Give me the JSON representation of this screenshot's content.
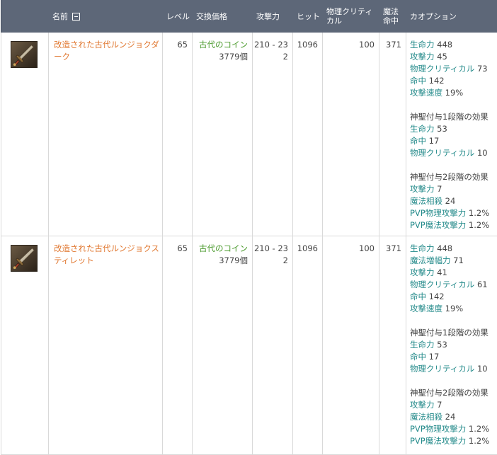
{
  "headers": {
    "name": "名前",
    "level": "レベル",
    "price": "交換価格",
    "attack": "攻撃力",
    "hit": "ヒット",
    "phys_crit": "物理クリティカル",
    "magic_acc": "魔法命中",
    "options": "カオプション"
  },
  "items": [
    {
      "name": "改造された古代ルンジョクダーク",
      "level": "65",
      "price_currency": "古代のコイン",
      "price_amount": "3779個",
      "attack": "210 - 232",
      "hit": "1096",
      "phys_crit": "100",
      "magic_acc": "371",
      "icon": "dagger-icon",
      "options": [
        {
          "type": "stat",
          "label": "生命力",
          "value": "448"
        },
        {
          "type": "stat",
          "label": "攻撃力",
          "value": "45"
        },
        {
          "type": "stat",
          "label": "物理クリティカル",
          "value": "73"
        },
        {
          "type": "stat",
          "label": "命中",
          "value": "142"
        },
        {
          "type": "stat",
          "label": "攻撃速度",
          "value": "19%"
        },
        {
          "type": "gap"
        },
        {
          "type": "heading",
          "text": "神聖付与1段階の効果"
        },
        {
          "type": "stat",
          "label": "生命力",
          "value": "53"
        },
        {
          "type": "stat",
          "label": "命中",
          "value": "17"
        },
        {
          "type": "stat",
          "label": "物理クリティカル",
          "value": "10"
        },
        {
          "type": "gap"
        },
        {
          "type": "heading",
          "text": "神聖付与2段階の効果"
        },
        {
          "type": "stat",
          "label": "攻撃力",
          "value": "7"
        },
        {
          "type": "stat",
          "label": "魔法相殺",
          "value": "24"
        },
        {
          "type": "stat",
          "label": "PVP物理攻撃力",
          "value": "1.2%"
        },
        {
          "type": "stat",
          "label": "PVP魔法攻撃力",
          "value": "1.2%"
        }
      ]
    },
    {
      "name": "改造された古代ルンジョクスティレット",
      "level": "65",
      "price_currency": "古代のコイン",
      "price_amount": "3779個",
      "attack": "210 - 232",
      "hit": "1096",
      "phys_crit": "100",
      "magic_acc": "371",
      "icon": "stiletto-icon",
      "options": [
        {
          "type": "stat",
          "label": "生命力",
          "value": "448"
        },
        {
          "type": "stat",
          "label": "魔法増幅力",
          "value": "71"
        },
        {
          "type": "stat",
          "label": "攻撃力",
          "value": "41"
        },
        {
          "type": "stat",
          "label": "物理クリティカル",
          "value": "61"
        },
        {
          "type": "stat",
          "label": "命中",
          "value": "142"
        },
        {
          "type": "stat",
          "label": "攻撃速度",
          "value": "19%"
        },
        {
          "type": "gap"
        },
        {
          "type": "heading",
          "text": "神聖付与1段階の効果"
        },
        {
          "type": "stat",
          "label": "生命力",
          "value": "53"
        },
        {
          "type": "stat",
          "label": "命中",
          "value": "17"
        },
        {
          "type": "stat",
          "label": "物理クリティカル",
          "value": "10"
        },
        {
          "type": "gap"
        },
        {
          "type": "heading",
          "text": "神聖付与2段階の効果"
        },
        {
          "type": "stat",
          "label": "攻撃力",
          "value": "7"
        },
        {
          "type": "stat",
          "label": "魔法相殺",
          "value": "24"
        },
        {
          "type": "stat",
          "label": "PVP物理攻撃力",
          "value": "1.2%"
        },
        {
          "type": "stat",
          "label": "PVP魔法攻撃力",
          "value": "1.2%"
        }
      ]
    }
  ],
  "colors": {
    "header_bg": "#5d6778",
    "item_name": "#e0762e",
    "currency": "#4a9a2c",
    "option_label": "#238a8a"
  }
}
